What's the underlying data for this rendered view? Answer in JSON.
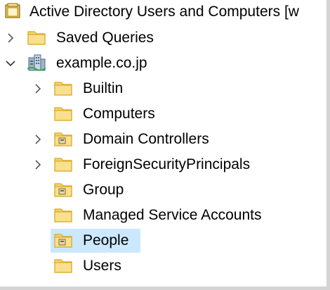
{
  "tree": {
    "root_label": "Active Directory Users and Computers [w",
    "saved_queries": {
      "label": "Saved Queries",
      "expanded": false
    },
    "domain": {
      "label": "example.co.jp",
      "expanded": true
    },
    "children": [
      {
        "label": "Builtin",
        "expandable": true
      },
      {
        "label": "Computers",
        "expandable": false
      },
      {
        "label": "Domain Controllers",
        "expandable": true
      },
      {
        "label": "ForeignSecurityPrincipals",
        "expandable": true
      },
      {
        "label": "Group",
        "expandable": false
      },
      {
        "label": "Managed Service Accounts",
        "expandable": false
      },
      {
        "label": "People",
        "expandable": false,
        "selected": true
      },
      {
        "label": "Users",
        "expandable": false
      }
    ]
  },
  "colors": {
    "selection": "#cce8ff",
    "folder": "#f6d36b",
    "folder_dark": "#d9a826"
  },
  "icons": {
    "root": "ad-console-icon",
    "folder": "folder-icon",
    "ou": "organizational-unit-icon",
    "domain": "domain-icon",
    "expand": "chevron-right-icon",
    "collapse": "chevron-down-icon"
  }
}
